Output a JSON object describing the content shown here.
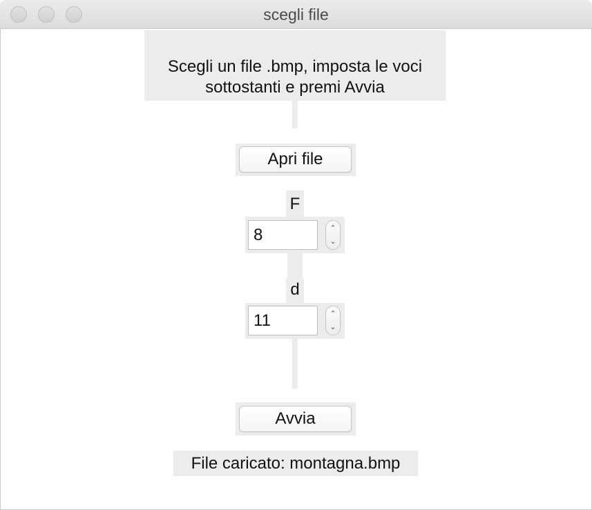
{
  "window": {
    "title": "scegli file"
  },
  "instructions": {
    "line1": "Scegli un file .bmp, imposta le voci",
    "line2": "sottostanti e premi Avvia"
  },
  "buttons": {
    "open_file": "Apri file",
    "start": "Avvia"
  },
  "fields": {
    "f_label": "F",
    "f_value": "8",
    "d_label": "d",
    "d_value": "11"
  },
  "icons": {
    "stepper_up": "chevron-up-icon",
    "stepper_down": "chevron-down-icon"
  },
  "status": {
    "text": "File caricato: montagna.bmp"
  }
}
